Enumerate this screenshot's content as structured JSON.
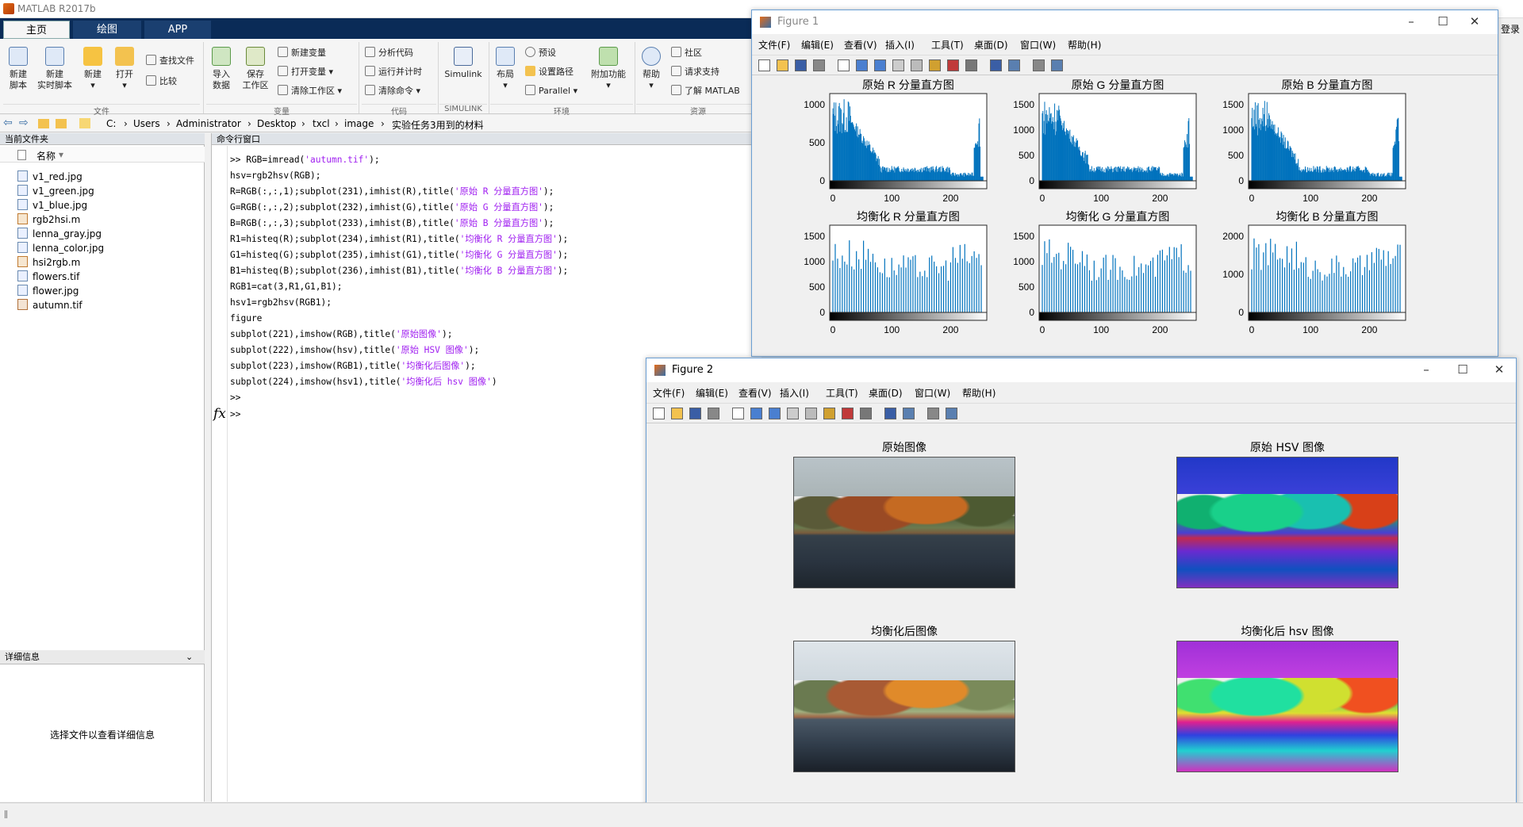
{
  "app": {
    "title": "MATLAB R2017b",
    "login": "登录"
  },
  "tabs": [
    "主页",
    "绘图",
    "APP"
  ],
  "ribbon": {
    "new_script": "新建\n脚本",
    "new_live": "新建\n实时脚本",
    "new": "新建",
    "open": "打开",
    "find_files": "查找文件",
    "compare": "比较",
    "import": "导入\n数据",
    "save_ws": "保存\n工作区",
    "new_var": "新建变量",
    "open_var": "打开变量",
    "clear_ws": "清除工作区",
    "analyze": "分析代码",
    "run_time": "运行并计时",
    "clear_cmd": "清除命令",
    "simulink": "Simulink",
    "layout": "布局",
    "prefs": "预设",
    "set_path": "设置路径",
    "parallel": "Parallel",
    "addons": "附加功能",
    "help": "帮助",
    "community": "社区",
    "request_support": "请求支持",
    "learn": "了解 MATLAB",
    "groups": {
      "file": "文件",
      "variable": "变量",
      "code": "代码",
      "simulink": "SIMULINK",
      "env": "环境",
      "resources": "资源"
    }
  },
  "address": [
    "C:",
    "Users",
    "Administrator",
    "Desktop",
    "txcl",
    "image",
    "实验任务3用到的材料"
  ],
  "files_panel": {
    "title": "当前文件夹",
    "col": "名称",
    "items": [
      "v1_red.jpg",
      "v1_green.jpg",
      "v1_blue.jpg",
      "rgb2hsi.m",
      "lenna_gray.jpg",
      "lenna_color.jpg",
      "hsi2rgb.m",
      "flowers.tif",
      "flower.jpg",
      "autumn.tif"
    ],
    "details_title": "详细信息",
    "details_msg": "选择文件以查看详细信息"
  },
  "cmd": {
    "title": "命令行窗口",
    "lines": [
      [
        ">> RGB=imread(",
        "'autumn.tif'",
        ");"
      ],
      [
        "hsv=rgb2hsv(RGB);",
        "",
        ""
      ],
      [
        "R=RGB(:,:,1);subplot(231),imhist(R),title(",
        "'原始 R 分量直方图'",
        ");"
      ],
      [
        "G=RGB(:,:,2);subplot(232),imhist(G),title(",
        "'原始 G 分量直方图'",
        ");"
      ],
      [
        "B=RGB(:,:,3);subplot(233),imhist(B),title(",
        "'原始 B 分量直方图'",
        ");"
      ],
      [
        "R1=histeq(R);subplot(234),imhist(R1),title(",
        "'均衡化 R 分量直方图'",
        ");"
      ],
      [
        "G1=histeq(G);subplot(235),imhist(G1),title(",
        "'均衡化 G 分量直方图'",
        ");"
      ],
      [
        "B1=histeq(B);subplot(236),imhist(B1),title(",
        "'均衡化 B 分量直方图'",
        ");"
      ],
      [
        "RGB1=cat(3,R1,G1,B1);",
        "",
        ""
      ],
      [
        "hsv1=rgb2hsv(RGB1);",
        "",
        ""
      ],
      [
        "figure",
        "",
        ""
      ],
      [
        "subplot(221),imshow(RGB),title(",
        "'原始图像'",
        ");"
      ],
      [
        "subplot(222),imshow(hsv),title(",
        "'原始 HSV 图像'",
        ");"
      ],
      [
        "subplot(223),imshow(RGB1),title(",
        "'均衡化后图像'",
        ");"
      ],
      [
        "subplot(224),imshow(hsv1),title(",
        "'均衡化后 hsv 图像'",
        ")"
      ],
      [
        ">>",
        "",
        ""
      ]
    ],
    "prompt": ">>",
    "fx": "fx"
  },
  "menus": [
    "文件(F)",
    "编辑(E)",
    "查看(V)",
    "插入(I)",
    "工具(T)",
    "桌面(D)",
    "窗口(W)",
    "帮助(H)"
  ],
  "figure1": {
    "title": "Figure 1",
    "plots": [
      {
        "title": "原始 R 分量直方图",
        "yticks": [
          "1000",
          "500",
          "0"
        ]
      },
      {
        "title": "原始 G 分量直方图",
        "yticks": [
          "1500",
          "1000",
          "500",
          "0"
        ]
      },
      {
        "title": "原始 B 分量直方图",
        "yticks": [
          "1500",
          "1000",
          "500",
          "0"
        ]
      },
      {
        "title": "均衡化 R 分量直方图",
        "yticks": [
          "1500",
          "1000",
          "500",
          "0"
        ]
      },
      {
        "title": "均衡化 G 分量直方图",
        "yticks": [
          "1500",
          "1000",
          "500",
          "0"
        ]
      },
      {
        "title": "均衡化 B 分量直方图",
        "yticks": [
          "2000",
          "1000",
          "0"
        ]
      }
    ],
    "xticks": [
      "0",
      "100",
      "200"
    ],
    "bar_color": "#0072bd"
  },
  "figure2": {
    "title": "Figure 2",
    "images": [
      "原始图像",
      "原始 HSV 图像",
      "均衡化后图像",
      "均衡化后 hsv 图像"
    ]
  }
}
